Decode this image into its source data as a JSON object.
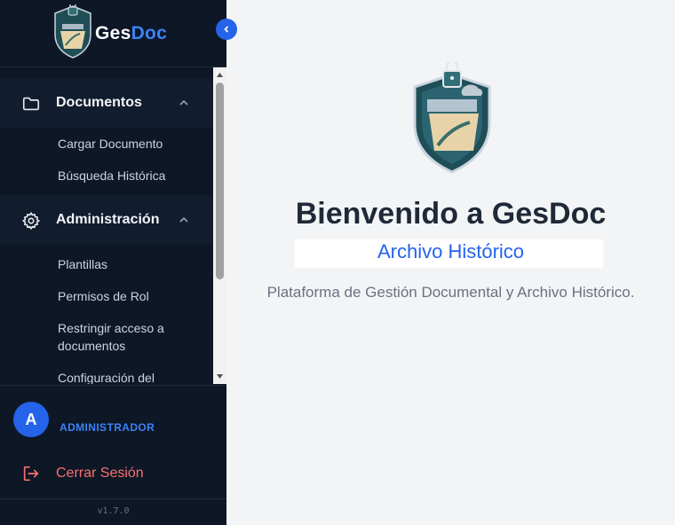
{
  "brand": {
    "name_part1": "Ges",
    "name_part2": "Doc",
    "logo": "gesdoc-shield-logo"
  },
  "collapse_icon": "chevron-left-icon",
  "nav": {
    "sections": [
      {
        "label": "Documentos",
        "icon": "folder-icon",
        "expanded": true,
        "items": [
          "Cargar Documento",
          "Búsqueda Histórica"
        ]
      },
      {
        "label": "Administración",
        "icon": "gear-icon",
        "expanded": true,
        "items": [
          "Plantillas",
          "Permisos de Rol",
          "Restringir acceso a documentos",
          "Configuración del"
        ]
      }
    ]
  },
  "user": {
    "initial": "A",
    "role": "ADMINISTRADOR"
  },
  "logout": {
    "label": "Cerrar Sesión",
    "icon": "logout-icon"
  },
  "version": "v1.7.0",
  "main": {
    "title": "Bienvenido a GesDoc",
    "subtitle": "Archivo Histórico",
    "description": "Plataforma de Gestión Documental y Archivo Histórico."
  },
  "colors": {
    "sidebar_bg": "#0e1726",
    "accent": "#2563eb",
    "brand_blue": "#3b82f6",
    "logout_red": "#f87171",
    "main_bg": "#f3f4f6"
  }
}
